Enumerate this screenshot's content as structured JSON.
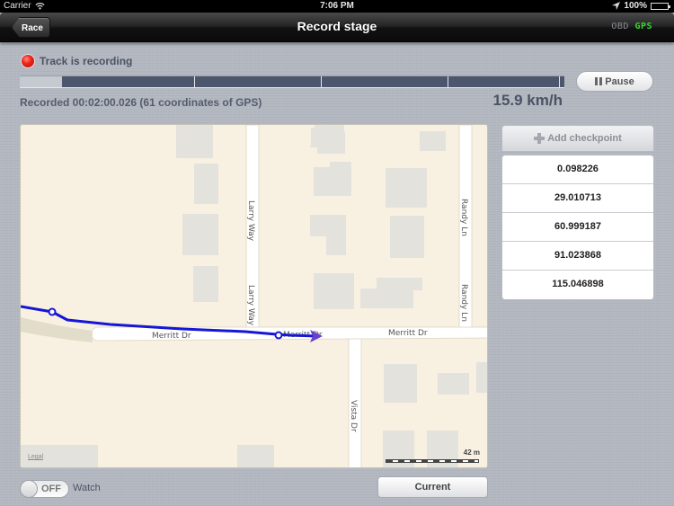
{
  "status_bar": {
    "carrier": "Carrier",
    "time": "7:06 PM",
    "battery": "100%"
  },
  "nav": {
    "back_label": "Race",
    "title": "Record stage",
    "obd_label": "OBD",
    "gps_label": "GPS",
    "colors": {
      "gps": "#35d62d",
      "obd": "#8a8d96"
    }
  },
  "recording": {
    "status": "Track is recording",
    "info": "Recorded 00:02:00.026 (61 coordinates of GPS)",
    "speed": "15.9 km/h",
    "pause_label": "Pause",
    "progress": {
      "lead_fraction": 0.078,
      "checkpoint_fractions": [
        0.32,
        0.553,
        0.786,
        0.99
      ]
    },
    "colors": {
      "fill": "#4c566d",
      "lead": "#c5c9d0",
      "dot": "#f0261a"
    }
  },
  "map": {
    "streets": [
      "Merritt Dr",
      "Merritt Dr",
      "Merritt Dr",
      "Larry Way",
      "Larry Way",
      "Randy Ln",
      "Randy Ln",
      "Vista Dr"
    ],
    "legal": "Legal",
    "scale": "42 m",
    "track_color": "#1616d6"
  },
  "checkpoints": {
    "add_label": "Add checkpoint",
    "items": [
      "0.098226",
      "29.010713",
      "60.999187",
      "91.023868",
      "115.046898"
    ]
  },
  "controls": {
    "watch_toggle": "OFF",
    "watch_label": "Watch",
    "current_label": "Current"
  }
}
